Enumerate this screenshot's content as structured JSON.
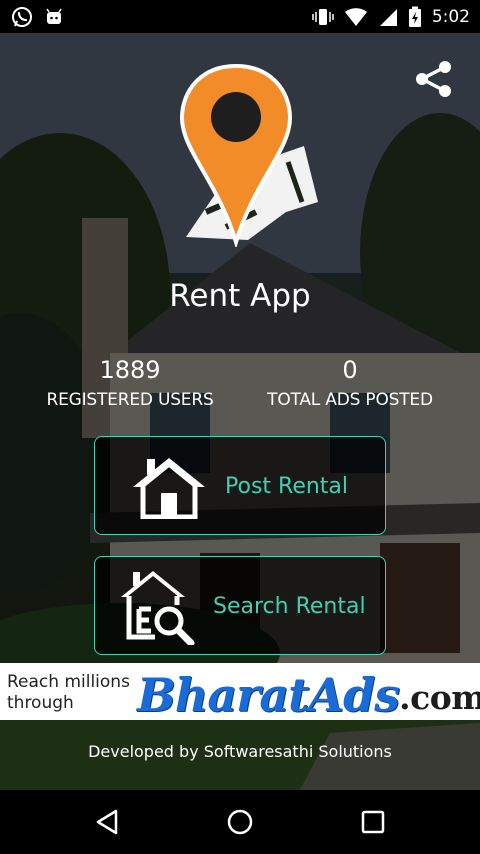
{
  "status_bar": {
    "time": "5:02",
    "left_icons": [
      "whatsapp-icon",
      "android-notification-icon"
    ],
    "right_icons": [
      "vibrate-icon",
      "wifi-icon",
      "cell-signal-icon",
      "battery-charging-icon"
    ]
  },
  "app": {
    "title": "Rent App",
    "logo_icon": "location-pin-hand-icon",
    "share_icon": "share-icon"
  },
  "stats": {
    "registered_users": {
      "value": "1889",
      "label": "REGISTERED USERS"
    },
    "total_ads": {
      "value": "0",
      "label": "TOTAL ADS POSTED"
    }
  },
  "actions": {
    "post": {
      "label": "Post Rental",
      "icon": "house-icon"
    },
    "search": {
      "label": "Search Rental",
      "icon": "house-search-icon"
    }
  },
  "ad": {
    "text_line1": "Reach millions",
    "text_line2": "through",
    "brand": "BharatAds",
    "tld": ".com"
  },
  "footer": {
    "developer": "Developed by Softwaresathi Solutions"
  },
  "colors": {
    "accent": "#3fd1b4",
    "logo_orange": "#f28c28",
    "ad_blue": "#1a6bd6"
  }
}
